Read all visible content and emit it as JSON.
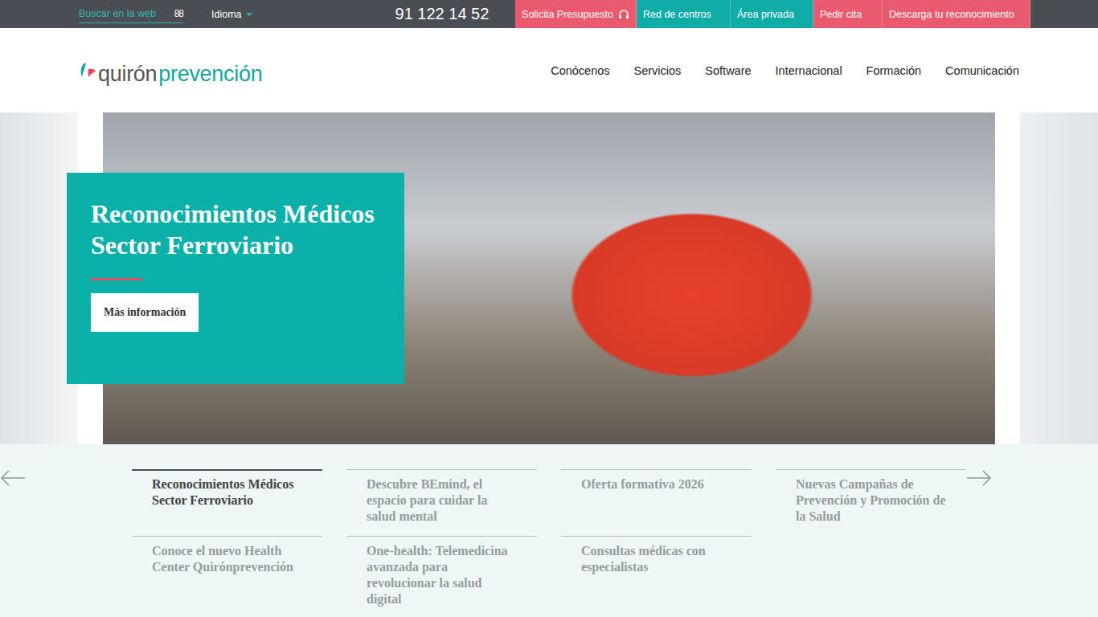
{
  "topbar": {
    "search": {
      "placeholder": "Buscar en la web",
      "icon": "88"
    },
    "language": "Idioma",
    "phone": "91 122 14 52",
    "buttons": [
      {
        "label": "Solicita Presupuesto",
        "color": "#ea5a6e",
        "icon": true
      },
      {
        "label": "Red de centros",
        "color": "#10aca7",
        "icon": false
      },
      {
        "label": "Área privada",
        "color": "#10aca7",
        "icon": false
      },
      {
        "label": "Pedir cita",
        "color": "#ea5a6e",
        "icon": false
      },
      {
        "label": "Descarga tu reconocimiento",
        "color": "#ea5a6e",
        "icon": false
      }
    ]
  },
  "logo": {
    "part1": "quirón",
    "part2": "prevención"
  },
  "nav": [
    "Conócenos",
    "Servicios",
    "Software",
    "Internacional",
    "Formación",
    "Comunicación"
  ],
  "hero": {
    "title": "Reconocimientos Médicos Sector Ferroviario",
    "button": "Más información"
  },
  "slides": [
    {
      "title": "Reconocimientos Médicos Sector Ferroviario",
      "selected": true
    },
    {
      "title": "Descubre BEmind, el espacio para cuidar la salud mental",
      "selected": false
    },
    {
      "title": "Oferta formativa 2026",
      "selected": false
    },
    {
      "title": "Nuevas Campañas de Prevención y Promoción de la Salud",
      "selected": false
    },
    {
      "title": "Conoce el nuevo Health Center Quirónprevención",
      "selected": false
    },
    {
      "title": "One-health: Telemedicina avanzada para revolucionar la salud digital",
      "selected": false
    },
    {
      "title": "Consultas médicas con especialistas",
      "selected": false
    }
  ]
}
